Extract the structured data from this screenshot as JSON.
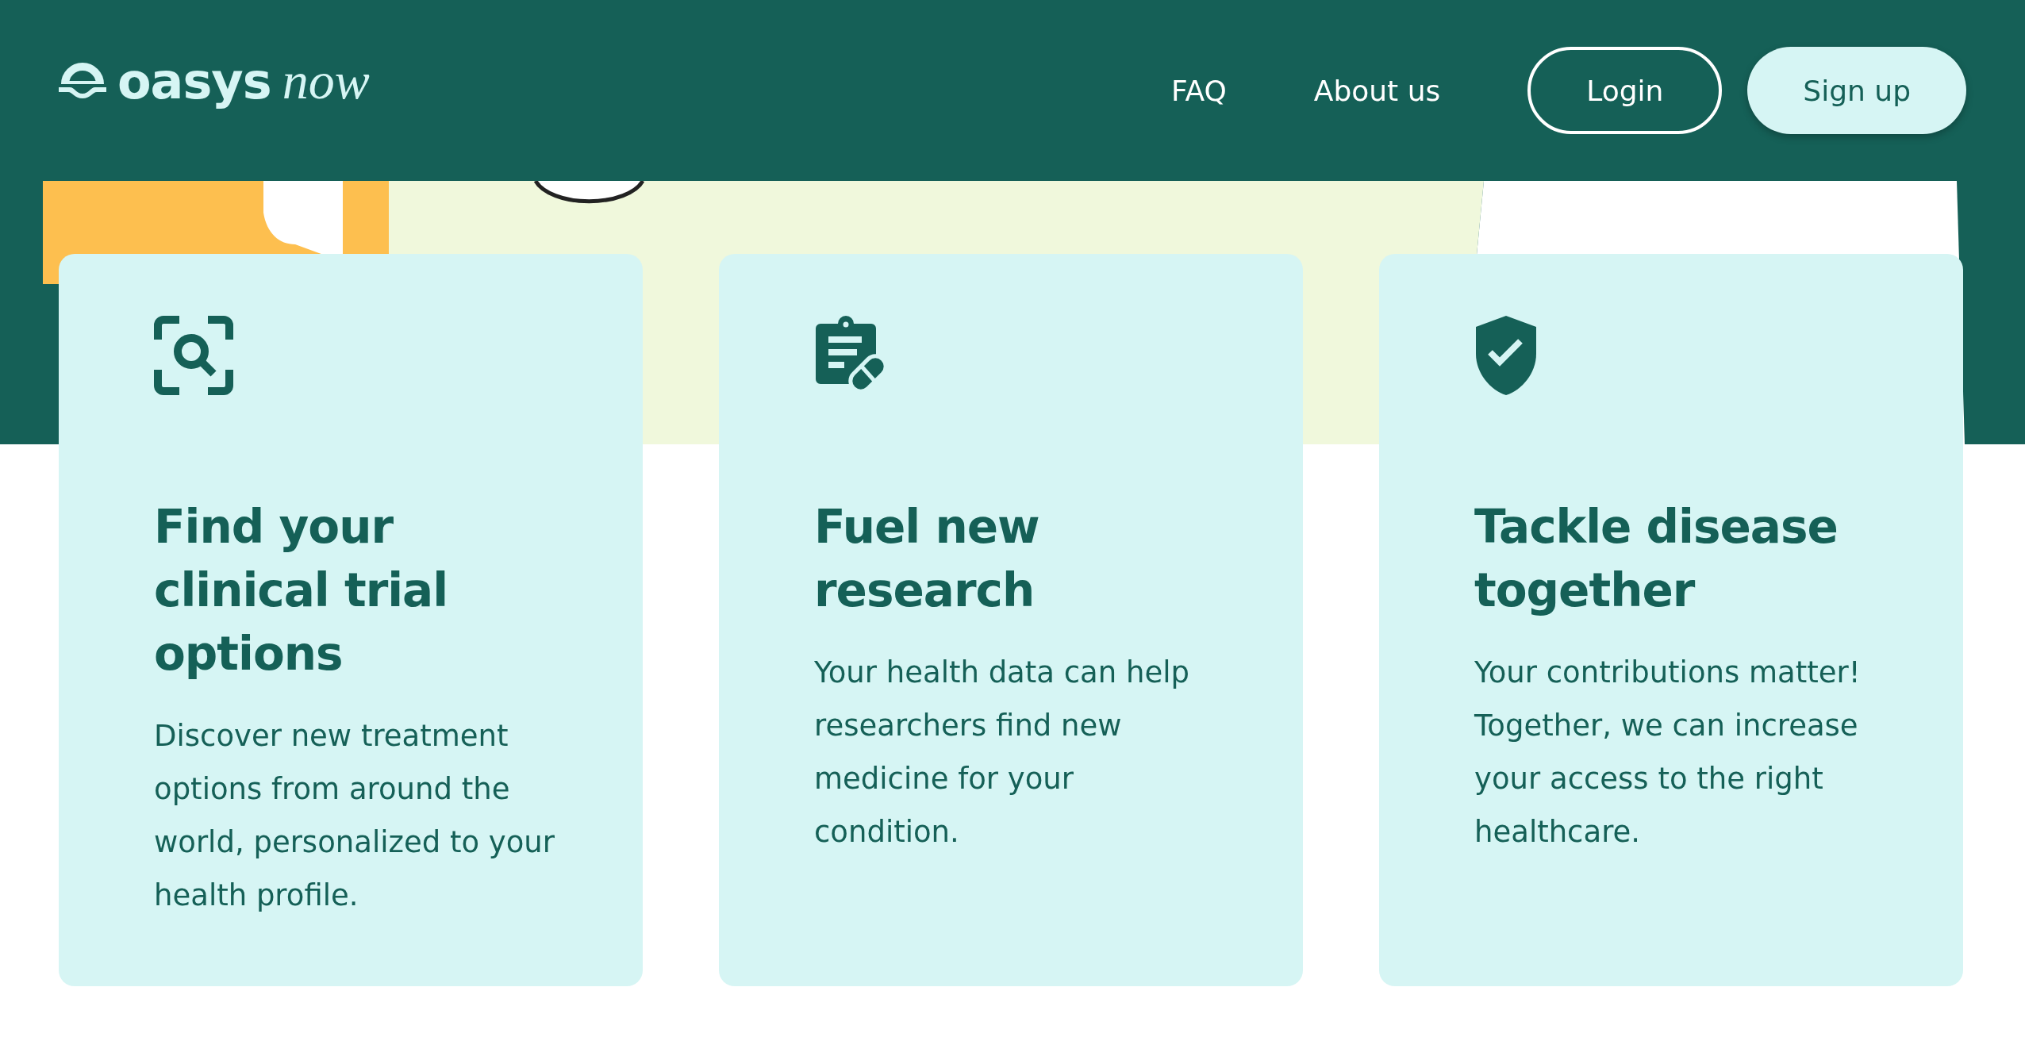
{
  "header": {
    "logo": {
      "word": "oasys",
      "suffix": "now"
    },
    "nav": [
      {
        "label": "FAQ"
      },
      {
        "label": "About us"
      }
    ],
    "buttons": [
      {
        "label": "Login",
        "kind": "outline"
      },
      {
        "label": "Sign up",
        "kind": "filled"
      }
    ]
  },
  "cards": [
    {
      "kind": "search",
      "title": "Find your clinical trial options",
      "text": "Discover new treatment options from around the world, personalized to your health profile."
    },
    {
      "kind": "clipboard",
      "title": "Fuel new research",
      "text": "Your health data can help researchers find new medicine for your condition."
    },
    {
      "kind": "shield",
      "title": "Tackle disease together",
      "text": "Your contributions matter! Together, we can increase your access to the right healthcare."
    }
  ]
}
